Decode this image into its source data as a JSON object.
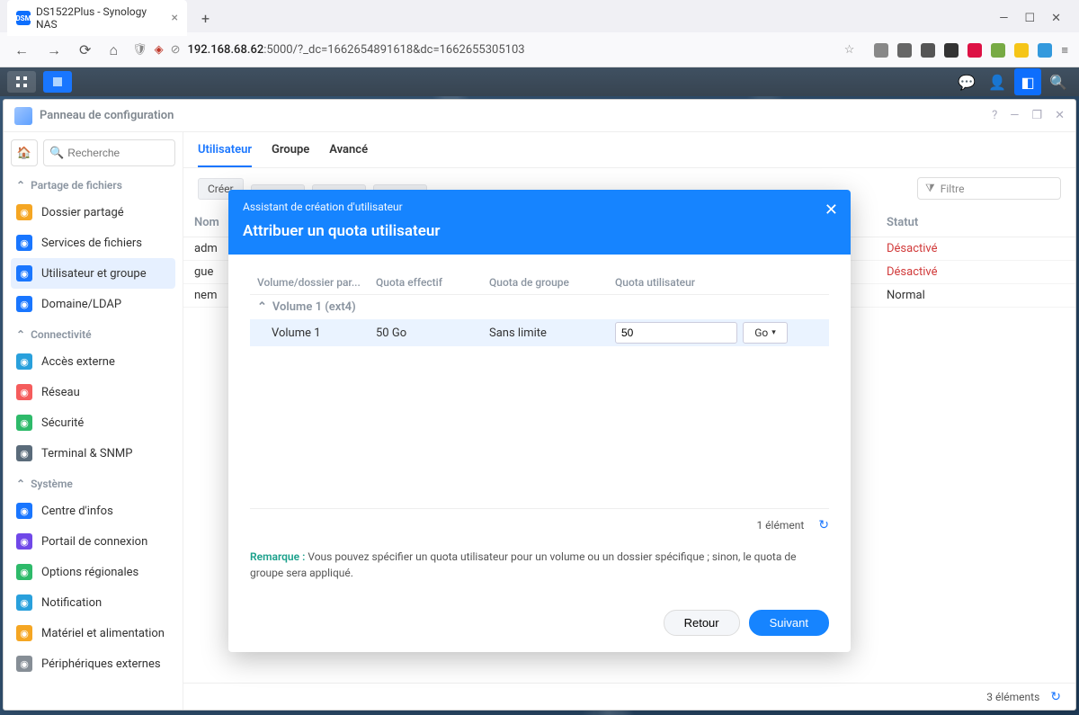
{
  "browser": {
    "tab_title": "DS1522Plus - Synology NAS",
    "favicon": "DSM",
    "url_host": "192.168.68.62",
    "url_rest": ":5000/?_dc=1662654891618&dc=1662655305103"
  },
  "window": {
    "title": "Panneau de configuration",
    "search_placeholder": "Recherche"
  },
  "sidebar": {
    "sections": [
      {
        "label": "Partage de fichiers",
        "items": [
          {
            "label": "Dossier partagé",
            "icon_bg": "#f5a623"
          },
          {
            "label": "Services de fichiers",
            "icon_bg": "#1976ff"
          },
          {
            "label": "Utilisateur et groupe",
            "icon_bg": "#1976ff",
            "active": true
          },
          {
            "label": "Domaine/LDAP",
            "icon_bg": "#1976ff"
          }
        ]
      },
      {
        "label": "Connectivité",
        "items": [
          {
            "label": "Accès externe",
            "icon_bg": "#29a0dc"
          },
          {
            "label": "Réseau",
            "icon_bg": "#f55c5c"
          },
          {
            "label": "Sécurité",
            "icon_bg": "#2eba6a"
          },
          {
            "label": "Terminal & SNMP",
            "icon_bg": "#5a6b7a"
          }
        ]
      },
      {
        "label": "Système",
        "items": [
          {
            "label": "Centre d'infos",
            "icon_bg": "#1976ff"
          },
          {
            "label": "Portail de connexion",
            "icon_bg": "#7048e8"
          },
          {
            "label": "Options régionales",
            "icon_bg": "#2eba6a"
          },
          {
            "label": "Notification",
            "icon_bg": "#29a0dc"
          },
          {
            "label": "Matériel et alimentation",
            "icon_bg": "#f5a623"
          },
          {
            "label": "Périphériques externes",
            "icon_bg": "#868e96"
          }
        ]
      }
    ]
  },
  "tabs": {
    "list": [
      "Utilisateur",
      "Groupe",
      "Avancé"
    ],
    "active": 0
  },
  "toolbar": {
    "create": "Créer",
    "filter": "Filtre"
  },
  "table": {
    "headers": {
      "name": "Nom",
      "status": "Statut"
    },
    "rows": [
      {
        "name": "admin",
        "status": "Désactivé",
        "status_cls": "st-disabled"
      },
      {
        "name": "guest",
        "status": "Désactivé",
        "status_cls": "st-disabled"
      },
      {
        "name": "nemrod",
        "status": "Normal",
        "status_cls": ""
      }
    ],
    "footer": "3 éléments"
  },
  "modal": {
    "subtitle": "Assistant de création d'utilisateur",
    "title": "Attribuer un quota utilisateur",
    "head": {
      "vol": "Volume/dossier par...",
      "eff": "Quota effectif",
      "grp": "Quota de groupe",
      "usr": "Quota utilisateur"
    },
    "group_row": "Volume 1 (ext4)",
    "row": {
      "vol": "Volume 1",
      "eff": "50 Go",
      "grp": "Sans limite",
      "usr_input": "50",
      "unit": "Go"
    },
    "pager": "1 élément",
    "note_label": "Remarque :",
    "note_text": "Vous pouvez spécifier un quota utilisateur pour un volume ou un dossier spécifique ; sinon, le quota de groupe sera appliqué.",
    "btn_back": "Retour",
    "btn_next": "Suivant"
  }
}
